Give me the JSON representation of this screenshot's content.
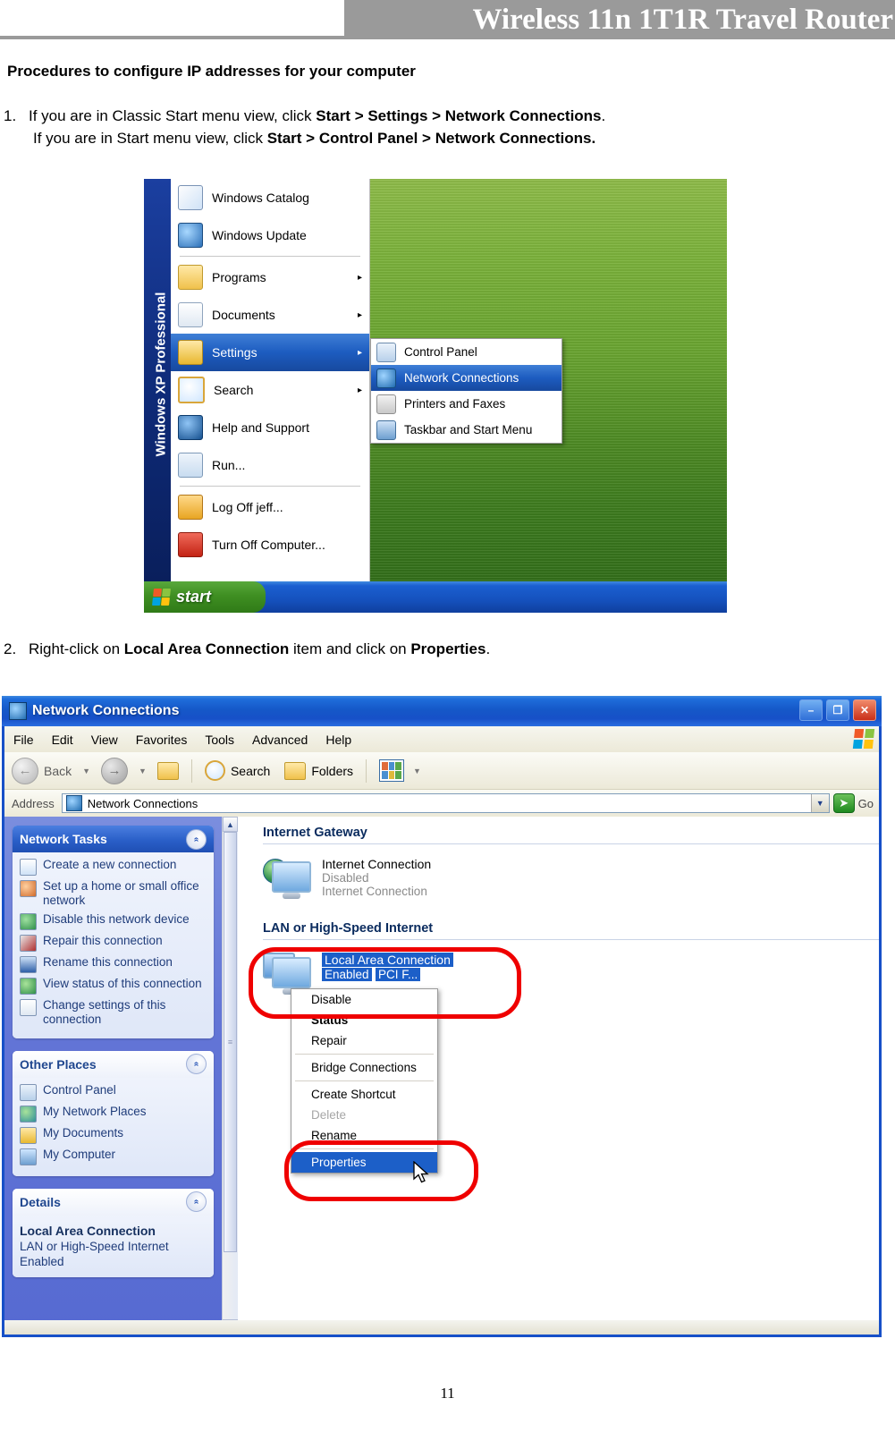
{
  "header": {
    "title": "Wireless 11n 1T1R Travel Router"
  },
  "document": {
    "section_title": "Procedures to configure IP addresses for your computer",
    "step1": {
      "number": "1.",
      "line1_a": "If you are in Classic Start menu view, click ",
      "line1_b": "Start > Settings > Network Connections",
      "line1_c": ".",
      "line2_a": "If you are in Start menu view, click ",
      "line2_b": "Start > Control Panel > Network Connections."
    },
    "step2": {
      "number": "2.",
      "a": "Right-click on ",
      "b": "Local Area Connection",
      "c": " item and click on ",
      "d": "Properties",
      "e": "."
    },
    "page_number": "11"
  },
  "start_menu": {
    "brand": "Windows XP Professional",
    "items": [
      {
        "label": "Windows Catalog",
        "icon": "windows-catalog-icon",
        "arrow": "",
        "selected": false
      },
      {
        "label": "Windows Update",
        "icon": "windows-update-icon",
        "arrow": "",
        "selected": false
      },
      {
        "label": "Programs",
        "icon": "programs-folder-icon",
        "arrow": "▸",
        "selected": false
      },
      {
        "label": "Documents",
        "icon": "documents-icon",
        "arrow": "▸",
        "selected": false
      },
      {
        "label": "Settings",
        "icon": "settings-icon",
        "arrow": "▸",
        "selected": true
      },
      {
        "label": "Search",
        "icon": "search-icon",
        "arrow": "▸",
        "selected": false
      },
      {
        "label": "Help and Support",
        "icon": "help-icon",
        "arrow": "",
        "selected": false
      },
      {
        "label": "Run...",
        "icon": "run-icon",
        "arrow": "",
        "selected": false
      },
      {
        "label": "Log Off jeff...",
        "icon": "log-off-icon",
        "arrow": "",
        "selected": false
      },
      {
        "label": "Turn Off Computer...",
        "icon": "turn-off-icon",
        "arrow": "",
        "selected": false
      }
    ],
    "submenu": [
      {
        "label": "Control Panel",
        "icon": "control-panel-icon",
        "selected": false
      },
      {
        "label": "Network Connections",
        "icon": "network-connections-icon",
        "selected": true
      },
      {
        "label": "Printers and Faxes",
        "icon": "printers-icon",
        "selected": false
      },
      {
        "label": "Taskbar and Start Menu",
        "icon": "taskbar-icon",
        "selected": false
      }
    ],
    "start_button": "start"
  },
  "window": {
    "title": "Network Connections",
    "title_icon": "network-connections-icon",
    "buttons": {
      "minimize": "–",
      "maximize": "❐",
      "close": "✕"
    },
    "menus": [
      "File",
      "Edit",
      "View",
      "Favorites",
      "Tools",
      "Advanced",
      "Help"
    ],
    "toolbar": {
      "back": "Back",
      "search": "Search",
      "folders": "Folders"
    },
    "address": {
      "label": "Address",
      "value": "Network Connections",
      "go": "Go"
    },
    "sidebar": {
      "panels": [
        {
          "title": "Network Tasks",
          "style": "blue",
          "items": [
            {
              "label": "Create a new connection",
              "icon": "new-connection-icon"
            },
            {
              "label": "Set up a home or small office network",
              "icon": "home-network-icon"
            },
            {
              "label": "Disable this network device",
              "icon": "disable-device-icon"
            },
            {
              "label": "Repair this connection",
              "icon": "repair-icon"
            },
            {
              "label": "Rename this connection",
              "icon": "rename-icon"
            },
            {
              "label": "View status of this connection",
              "icon": "view-status-icon"
            },
            {
              "label": "Change settings of this connection",
              "icon": "change-settings-icon"
            }
          ]
        },
        {
          "title": "Other Places",
          "style": "lite",
          "items": [
            {
              "label": "Control Panel",
              "icon": "control-panel-icon"
            },
            {
              "label": "My Network Places",
              "icon": "my-network-places-icon"
            },
            {
              "label": "My Documents",
              "icon": "my-documents-icon"
            },
            {
              "label": "My Computer",
              "icon": "my-computer-icon"
            }
          ]
        }
      ],
      "details": {
        "title": "Details",
        "name": "Local Area Connection",
        "line2": "LAN or High-Speed Internet",
        "line3": "Enabled"
      }
    },
    "list": {
      "group1": "Internet Gateway",
      "gateway": {
        "name": "Internet Connection",
        "status": "Disabled",
        "device": "Internet Connection"
      },
      "group2": "LAN or High-Speed Internet",
      "lan": {
        "name": "Local Area Connection",
        "status": "Enabled",
        "device": "PCI F..."
      }
    },
    "context_menu": [
      {
        "label": "Disable",
        "state": "normal"
      },
      {
        "label": "Status",
        "state": "bold"
      },
      {
        "label": "Repair",
        "state": "normal"
      },
      {
        "label": "__sep__",
        "state": "sep"
      },
      {
        "label": "Bridge Connections",
        "state": "normal"
      },
      {
        "label": "__sep__",
        "state": "sep"
      },
      {
        "label": "Create Shortcut",
        "state": "normal"
      },
      {
        "label": "Delete",
        "state": "disabled"
      },
      {
        "label": "Rename",
        "state": "normal"
      },
      {
        "label": "__sep__",
        "state": "sep"
      },
      {
        "label": "Properties",
        "state": "selected"
      }
    ]
  },
  "colors": {
    "header_band": "#9a9a9a",
    "highlight_ring": "#ef0000",
    "xp_blue": "#1750c8",
    "selection": "#1c5fc8",
    "sidebar_blue": "#6375d6"
  }
}
